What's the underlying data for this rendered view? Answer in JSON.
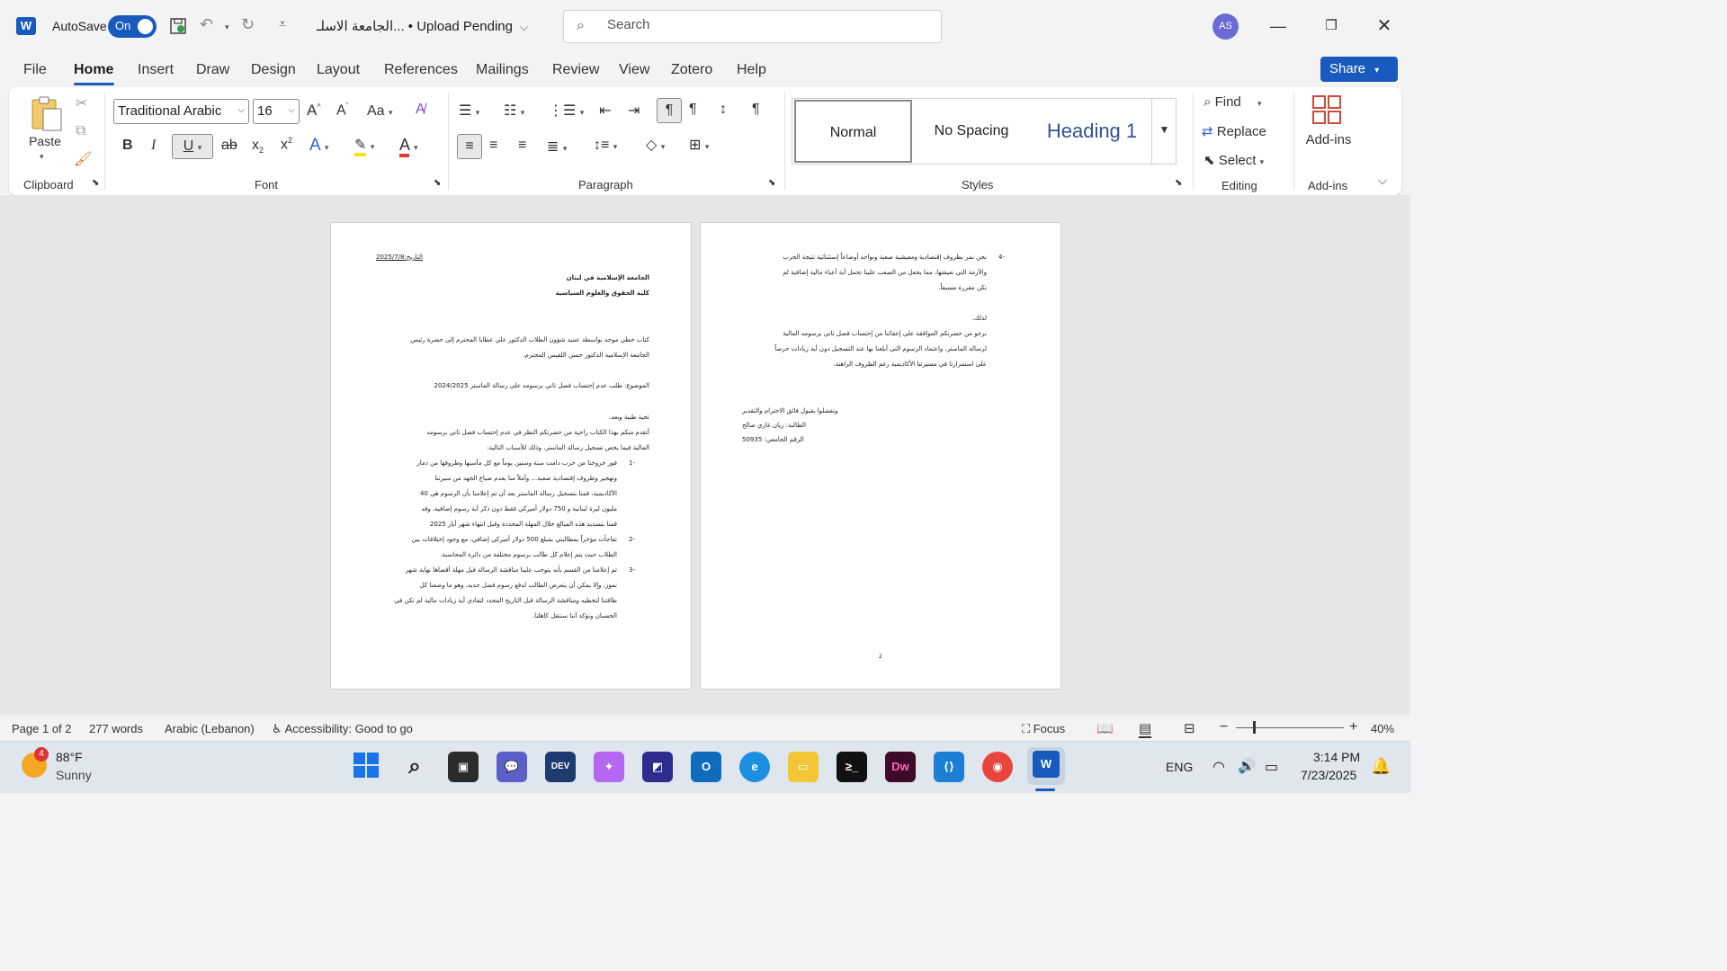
{
  "titlebar": {
    "app_logo": "W",
    "autosave_label": "AutoSave",
    "autosave_state": "On",
    "doc_title": "الجامعة الاسلـ... • Upload Pending",
    "search_placeholder": "Search",
    "avatar_initials": "AS"
  },
  "tabs": [
    "File",
    "Home",
    "Insert",
    "Draw",
    "Design",
    "Layout",
    "References",
    "Mailings",
    "Review",
    "View",
    "Zotero",
    "Help"
  ],
  "active_tab": "Home",
  "share_label": "Share",
  "ribbon": {
    "clipboard": {
      "paste": "Paste",
      "label": "Clipboard"
    },
    "font": {
      "family": "Traditional Arabic",
      "size": "16",
      "label": "Font"
    },
    "paragraph": {
      "label": "Paragraph"
    },
    "styles": {
      "normal": "Normal",
      "no_spacing": "No Spacing",
      "heading1": "Heading 1",
      "label": "Styles"
    },
    "editing": {
      "find": "Find",
      "replace": "Replace",
      "select": "Select",
      "label": "Editing"
    },
    "addins": {
      "button": "Add-ins",
      "label": "Add-ins"
    }
  },
  "page1": {
    "date": "التاريخ:2025/7/8",
    "uni": "الجامعة الإسلامية في لبنان",
    "faculty": "كلية الحقوق والعلوم السياسية",
    "p1a": "كتاب خطي موجه بواسطة عميد شؤون الطلاب الدكتور علي عطايا المحترم إلى حضرة رئيس",
    "p1b": "الجامعة الإسلامية الدكتور حسن اللقيس المحترم.",
    "subject": "الموضوع: طلب عدم إحتساب فصل ثاني برسومه على رسالة الماستر 2024/2025",
    "greet": "تحية طيبة وبعد،",
    "p2a": "أتقدم منكم بهذا الكتاب راجية من حضرتكم النظر في عدم إحتساب فصل ثاني برسومه",
    "p2b": "المالية فيما يخص تسجيل رسالة الماستر، وذلك للأسباب التالية:",
    "i1n": "1-",
    "i1a": "فور خروجنا من حرب دامت سنة وستين يوماً مع كل مآسيها وظروفها من دمار",
    "i1b": "وتهجير وظروف إقتصادية صعبة... وأملاً منا بعدم ضياع الجهد من سيرتنا",
    "i1c": "الأكاديمية، قمنا بتسجيل رسالة الماستر بعد أن تم إعلامنا بأن الرسوم هي 40",
    "i1d": "مليون ليرة لبنانية و 750 دولار أميركي فقط دون ذكر أية رسوم إضافية، وقد",
    "i1e": "قمنا بتسديد هذه المبالغ خلال المهلة المحددة وقبل انتهاء شهر أيار 2025",
    "i2n": "2-",
    "i2a": "تفاجأت مؤخراً بمطالبتي بمبلغ 500 دولار أميركي إضافي، مع وجود إختلافات بين",
    "i2b": "الطلاب حيث يتم إعلام كل طالب برسوم مختلفة من دائرة المحاسبة.",
    "i3n": "3-",
    "i3a": "تم إعلامنا من القسم بأنه يتوجب علينا مناقشة الرسالة قبل مهلة أقصاها نهاية شهر",
    "i3b": "تموز، وإلا يمكن أن يتعرض الطالب لدفع رسوم فصل جديد، وهو ما وضعنا كل",
    "i3c": "طاقتنا لتخطيه ومناقشة الرسالة قبل التاريخ المحدد لتفادي أية زيادات مالية لم تكن في",
    "i3d": "الحسبان ونؤكد أننا سنتقل كاهلنا."
  },
  "page2": {
    "i4n": "4-",
    "i4a": "نحن نمر بظروف إقتصادية ومعيشية صعبة ونواجه أوضاعاً إستثنائية نتيجة الحرب",
    "i4b": "والأزمة التي نعيشها، مما يجعل من الصعب علينا تحمل أية أعباء مالية إضافية لم",
    "i4c": "تكن مقررة مسبقاً.",
    "therefore": "لذلك،",
    "r1": "نرجو من حضرتكم الموافقة على إعفائنا من إحتساب فصل ثاني برسومه المالية",
    "r2": "لرسالة الماستر، واعتماد الرسوم التي أبلغنا بها عند التسجيل دون أية زيادات حرصاً",
    "r3": "على استمرارنا في مسيرتنا الأكاديمية رغم الظروف الراهنة.",
    "closing": "وتفضلوا بقبول فائق الاحترام والتقدير",
    "student": "الطالبة: ريان غازي صالح",
    "id": "الرقم الجامعي: 50935",
    "page_num": "2"
  },
  "status": {
    "page": "Page 1 of 2",
    "words": "277 words",
    "lang": "Arabic (Lebanon)",
    "access": "Accessibility: Good to go",
    "focus": "Focus",
    "zoom": "40%"
  },
  "taskbar": {
    "weather_temp": "88°F",
    "weather_desc": "Sunny",
    "weather_badge": "4",
    "lang": "ENG",
    "time": "3:14 PM",
    "date": "7/23/2025"
  },
  "colors": {
    "accent": "#185abd",
    "taskbar": "#dfe6ee",
    "canvas": "#e6e6e6"
  }
}
